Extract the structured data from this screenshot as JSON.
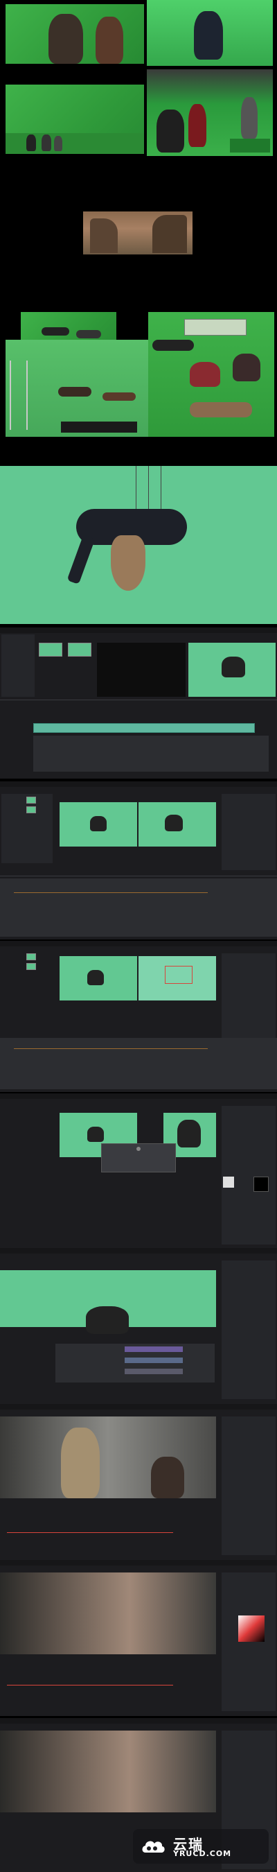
{
  "page": {
    "title": "",
    "watermark": {
      "cn": "云瑞",
      "en": "YRUCD.COM",
      "logo_icon": "cloud-logo-icon"
    }
  },
  "frames": [
    {
      "id": "greenscreen-actors-back",
      "kind": "photo"
    },
    {
      "id": "greenscreen-flying-hero",
      "kind": "photo"
    },
    {
      "id": "greenscreen-studio-wide",
      "kind": "photo"
    },
    {
      "id": "greenscreen-rig-wire",
      "kind": "photo"
    },
    {
      "id": "fantasy-cliff-matte",
      "kind": "photo"
    },
    {
      "id": "greenscreen-jump-collage",
      "kind": "photo"
    },
    {
      "id": "wire-hang-closeup",
      "kind": "photo"
    },
    {
      "id": "resolve-edit-page",
      "kind": "screenshot"
    },
    {
      "id": "resolve-fusion-page-1",
      "kind": "screenshot"
    },
    {
      "id": "resolve-fusion-page-2",
      "kind": "screenshot"
    },
    {
      "id": "resolve-fusion-page-3",
      "kind": "screenshot"
    },
    {
      "id": "resolve-color-page-1",
      "kind": "screenshot"
    },
    {
      "id": "resolve-color-page-2",
      "kind": "screenshot"
    },
    {
      "id": "resolve-color-page-3",
      "kind": "screenshot"
    },
    {
      "id": "resolve-color-page-4",
      "kind": "screenshot"
    }
  ],
  "colors": {
    "background": "#000000",
    "greenscreen": "#3fb24a",
    "keyed_green": "#62c892",
    "ui_dark": "#1c1c1f",
    "ui_panel": "#25262a",
    "accent_red": "#d8453b"
  }
}
